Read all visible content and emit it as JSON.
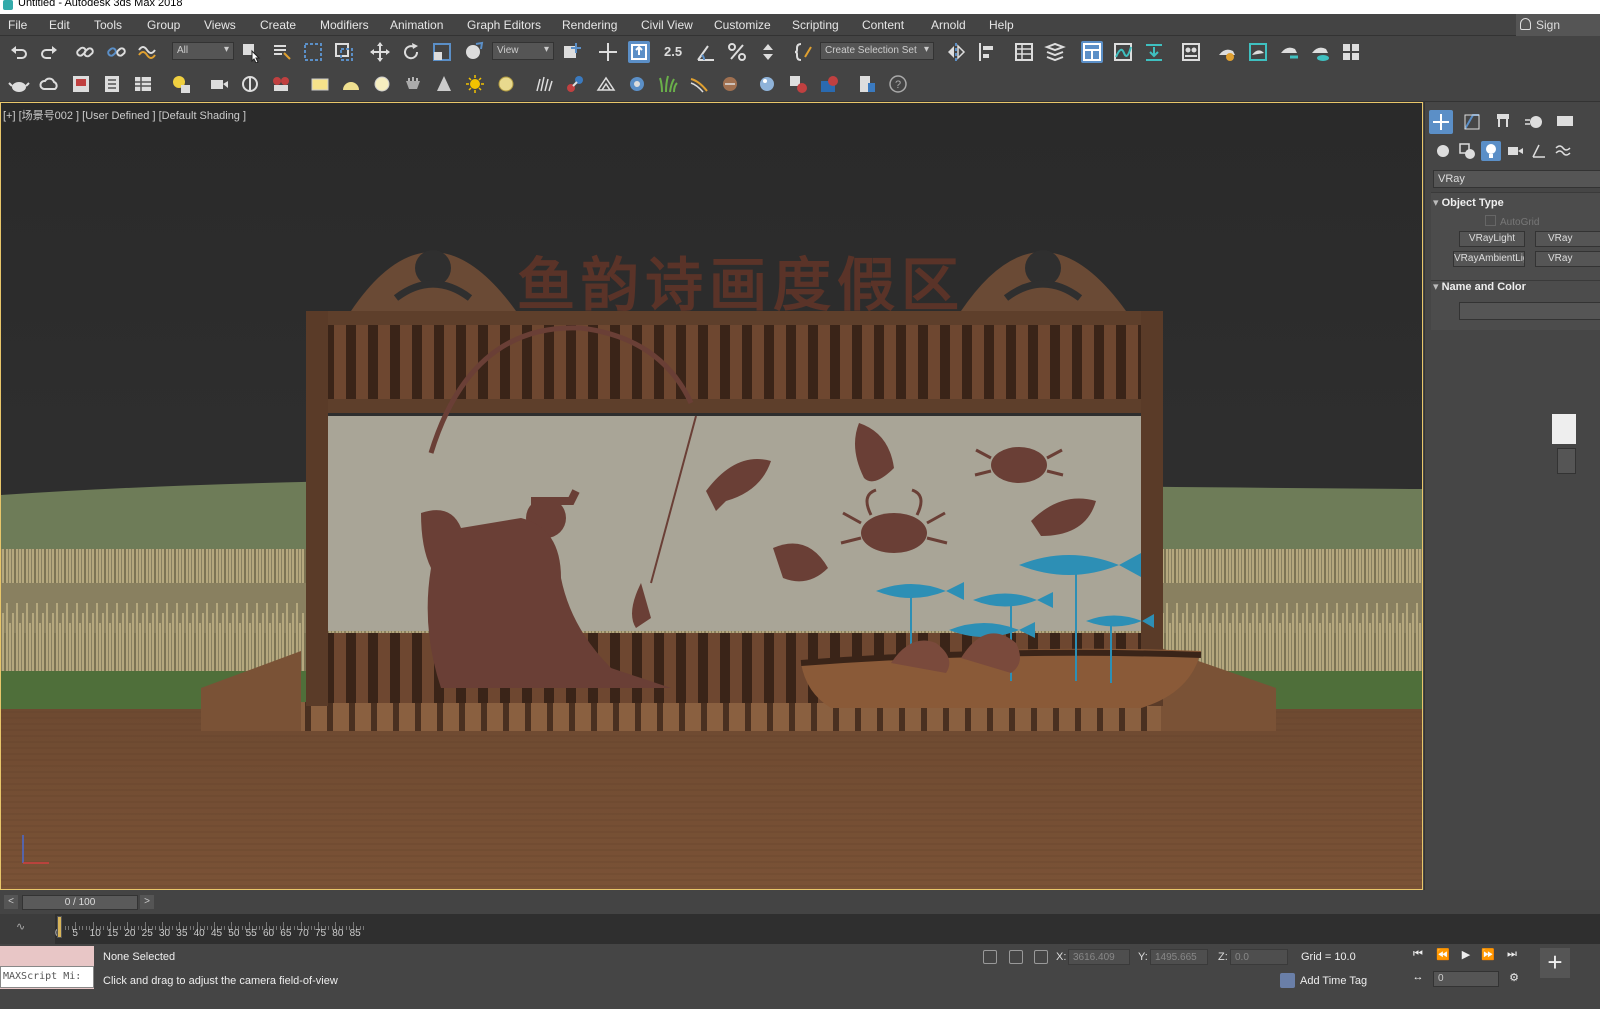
{
  "window": {
    "title": "Untitled - Autodesk 3ds Max 2018"
  },
  "menu": [
    "File",
    "Edit",
    "Tools",
    "Group",
    "Views",
    "Create",
    "Modifiers",
    "Animation",
    "Graph Editors",
    "Rendering",
    "Civil View",
    "Customize",
    "Scripting",
    "Content",
    "Arnold",
    "Help"
  ],
  "account": {
    "sign_in_label": "Sign"
  },
  "toolbar": {
    "selection_filter": "All",
    "reference_coord": "View",
    "snap_label": "2.5",
    "named_selection": "Create Selection Set"
  },
  "viewport": {
    "label": "[+] [场景号002 ] [User Defined ] [Default Shading ]",
    "sign_text": "鱼韵诗画度假区"
  },
  "command_panel": {
    "category": "VRay",
    "object_type_title": "Object Type",
    "autogrid_label": "AutoGrid",
    "buttons": [
      "VRayLight",
      "VRay",
      "VRayAmbientLig",
      "VRay"
    ],
    "name_color_title": "Name and Color"
  },
  "timeline": {
    "frame_display": "0 / 100",
    "ticks": [
      0,
      5,
      10,
      15,
      20,
      25,
      30,
      35,
      40,
      45,
      50,
      55,
      60,
      65,
      70,
      75,
      80,
      85
    ]
  },
  "status": {
    "maxscript_text": "MAXScript Mi:",
    "selection": "None Selected",
    "prompt": "Click and drag to adjust the camera field-of-view",
    "x_label": "X:",
    "x_value": "3616.409",
    "y_label": "Y:",
    "y_value": "1495.665",
    "z_label": "Z:",
    "z_value": "0.0",
    "grid": "Grid = 10.0",
    "add_time_tag": "Add Time Tag",
    "current_frame": "0"
  },
  "colors": {
    "accent": "#5b8fc7",
    "viewport_border": "#e8c66a",
    "ui_background": "#444444",
    "wood": "#6b4a33",
    "sign_panel": "#a9a597",
    "silhouette": "#6a3f36",
    "fish_blue": "#2d8fb5"
  }
}
